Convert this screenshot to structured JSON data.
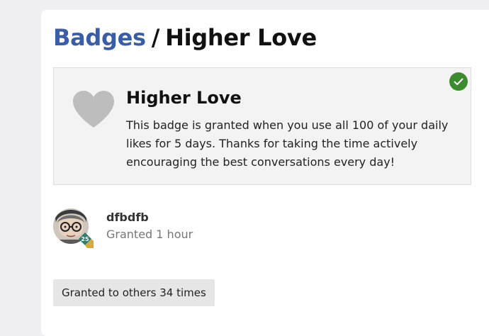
{
  "breadcrumb": {
    "parent_label": "Badges",
    "separator": "/",
    "current_label": "Higher Love"
  },
  "badge": {
    "icon": "heart-icon",
    "name": "Higher Love",
    "description": "This badge is granted when you use all 100 of your daily likes for 5 days. Thanks for taking the time actively encouraging the best conversations every day!",
    "granted_icon": "check-circle-icon"
  },
  "grant": {
    "username": "dfbdfb",
    "time": "Granted 1 hour",
    "level": "25"
  },
  "others": {
    "label": "Granted to others 34 times"
  },
  "colors": {
    "link": "#3a5da8",
    "success": "#3d8b2f",
    "heart": "#bdbdbd",
    "level_badge": "#2f7d6b"
  }
}
